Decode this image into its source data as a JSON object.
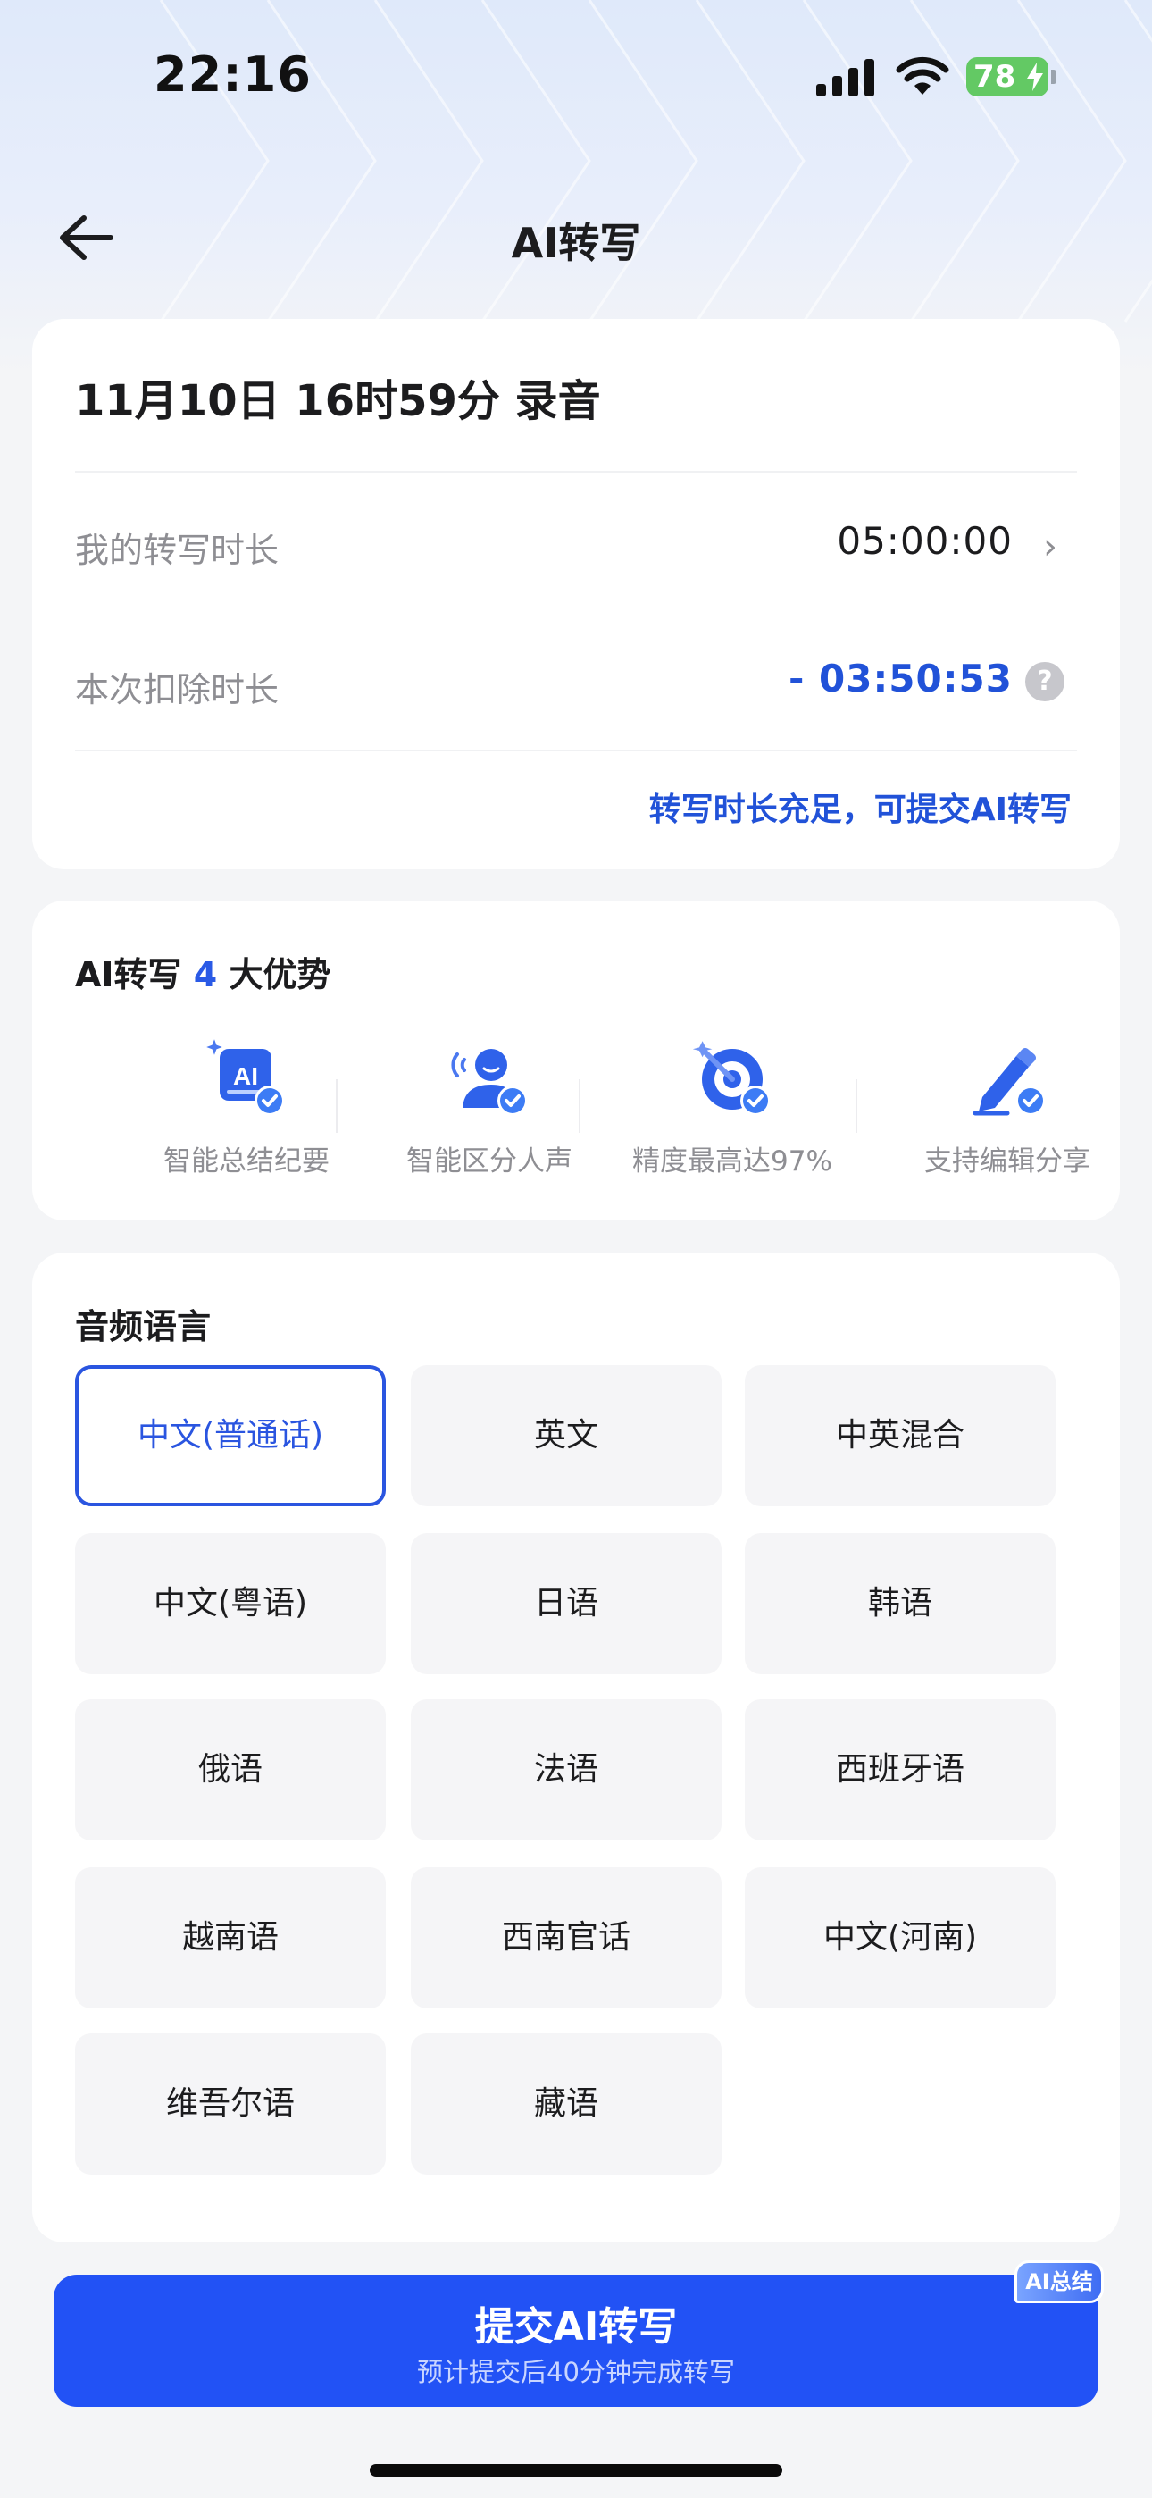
{
  "status_bar": {
    "time": "22:16",
    "battery": "78"
  },
  "nav": {
    "title": "AI转写"
  },
  "record": {
    "title": "11月10日 16时59分 录音",
    "my_duration_label": "我的转写时长",
    "my_duration_value": "05:00:00",
    "deduct_label": "本次扣除时长",
    "deduct_value": "- 03:50:53",
    "note": "转写时长充足，可提交AI转写"
  },
  "advantages": {
    "title_prefix": "AI转写",
    "title_count": "4",
    "title_suffix": "大优势",
    "items": [
      {
        "label": "智能总结纪要",
        "icon": "ai-summary-icon"
      },
      {
        "label": "智能区分人声",
        "icon": "speaker-identify-icon"
      },
      {
        "label": "精度最高达97%",
        "icon": "accuracy-target-icon"
      },
      {
        "label": "支持编辑分享",
        "icon": "edit-pen-icon"
      }
    ]
  },
  "language": {
    "title": "音频语言",
    "selected": "中文(普通话)",
    "options": [
      "中文(普通话)",
      "英文",
      "中英混合",
      "中文(粤语)",
      "日语",
      "韩语",
      "俄语",
      "法语",
      "西班牙语",
      "越南语",
      "西南官话",
      "中文(河南)",
      "维吾尔语",
      "藏语"
    ]
  },
  "submit": {
    "label": "提交AI转写",
    "sub_label": "预计提交后40分钟完成转写",
    "badge": "AI总结"
  },
  "colors": {
    "accent": "#2252f5",
    "accent_text": "#2152d8",
    "battery": "#63c964"
  }
}
